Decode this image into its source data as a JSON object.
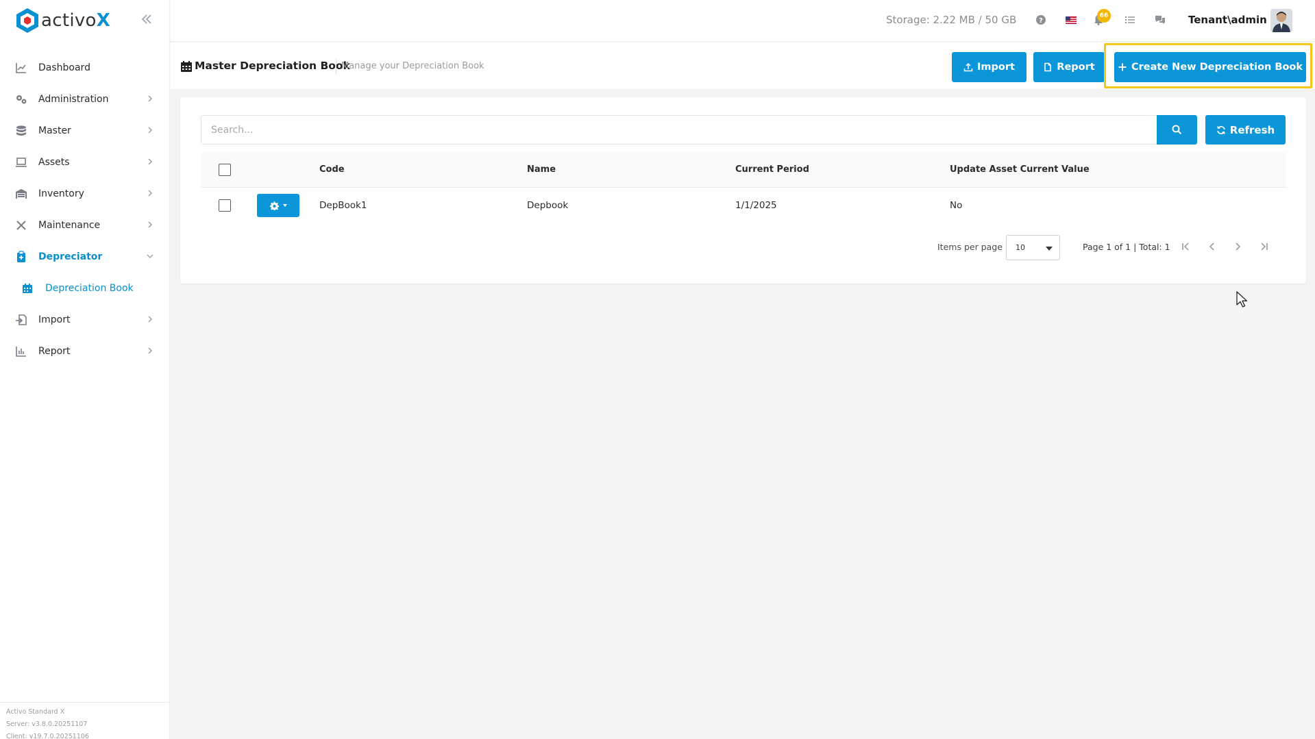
{
  "brand": {
    "name_main": "activo",
    "name_accent": "X",
    "accent_color": "#0a8fd0"
  },
  "sidebar": {
    "items": [
      {
        "label": "Dashboard",
        "icon": "chart-line-icon",
        "expandable": false
      },
      {
        "label": "Administration",
        "icon": "cogs-icon",
        "expandable": true
      },
      {
        "label": "Master",
        "icon": "database-icon",
        "expandable": true
      },
      {
        "label": "Assets",
        "icon": "laptop-icon",
        "expandable": true
      },
      {
        "label": "Inventory",
        "icon": "warehouse-icon",
        "expandable": true
      },
      {
        "label": "Maintenance",
        "icon": "tools-icon",
        "expandable": true
      },
      {
        "label": "Depreciator",
        "icon": "clipboard-icon",
        "expandable": true,
        "active": true
      },
      {
        "label": "Import",
        "icon": "file-import-icon",
        "expandable": true
      },
      {
        "label": "Report",
        "icon": "chart-bar-icon",
        "expandable": true
      }
    ],
    "sub_item": {
      "label": "Depreciation Book",
      "icon": "calendar-icon"
    },
    "footer": {
      "product": "Activo Standard X",
      "server": "Server: v3.8.0.20251107",
      "client": "Client: v19.7.0.20251106"
    }
  },
  "topbar": {
    "storage": "Storage: 2.22 MB / 50 GB",
    "notification_count": "66",
    "user": "Tenant\\admin"
  },
  "page": {
    "title": "Master Depreciation Book",
    "subtitle": "Manage your Depreciation Book",
    "import_label": "Import",
    "report_label": "Report",
    "create_label": "Create New Depreciation Book"
  },
  "search": {
    "placeholder": "Search...",
    "refresh_label": "Refresh"
  },
  "table": {
    "headers": {
      "code": "Code",
      "name": "Name",
      "current_period": "Current Period",
      "update_value": "Update Asset Current Value"
    },
    "rows": [
      {
        "code": "DepBook1",
        "name": "Depbook",
        "current_period": "1/1/2025",
        "update_value": "No"
      }
    ]
  },
  "pager": {
    "items_per_page_label": "Items per page",
    "items_per_page_value": "10",
    "info": "Page 1 of 1 | Total: 1"
  },
  "colors": {
    "primary": "#0a96d8",
    "highlight": "#f5c518",
    "badge": "#f2b705"
  }
}
